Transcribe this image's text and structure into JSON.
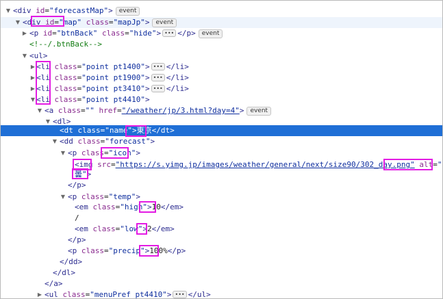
{
  "lines": [
    {
      "open": "<",
      "tag": "div",
      "a1n": "id",
      "a1v": "\"forecastMap\"",
      "close": ">",
      "badge": "event"
    },
    {
      "open": "<",
      "tag": "div",
      "a1n": "id",
      "a1v": "\"map\"",
      "a2n": "class",
      "a2v": "\"mapJp\"",
      "close": ">",
      "badge": "event"
    },
    {
      "open": "<",
      "tag": "p",
      "a1n": "id",
      "a1v": "\"btnBack\"",
      "a2n": "class",
      "a2v": "\"hide\"",
      "mid": ">",
      "dots": "•••",
      "end": "</p>",
      "badge": "event"
    },
    {
      "comment": "<!--/.btnBack-->"
    },
    {
      "open": "<",
      "tag": "ul",
      "close": ">"
    },
    {
      "open": "<",
      "tag": "li",
      "a1n": "class",
      "a1v": "\"point pt1400\"",
      "mid": ">",
      "dots": "•••",
      "end": "</li>"
    },
    {
      "open": "<",
      "tag": "li",
      "a1n": "class",
      "a1v": "\"point pt1900\"",
      "mid": ">",
      "dots": "•••",
      "end": "</li>"
    },
    {
      "open": "<",
      "tag": "li",
      "a1n": "class",
      "a1v": "\"point pt3410\"",
      "mid": ">",
      "dots": "•••",
      "end": "</li>"
    },
    {
      "open": "<",
      "tag": "li",
      "a1n": "class",
      "a1v": "\"point pt4410\"",
      "close": ">"
    },
    {
      "open": "<",
      "tag": "a",
      "a1n": "class",
      "a1v": "\"\"",
      "a2n": "href",
      "a2v": "\"/weather/jp/3.html?day=4\"",
      "close": ">",
      "badge": "event"
    },
    {
      "open": "<",
      "tag": "dl",
      "close": ">"
    },
    {
      "open": "<",
      "tag": "dt",
      "a1n": "class",
      "a1v": "\"name\"",
      "mid": ">",
      "text": "東京",
      "end": "</dt>"
    },
    {
      "open": "<",
      "tag": "dd",
      "a1n": "class",
      "a1v": "\"forecast\"",
      "close": ">"
    },
    {
      "open": "<",
      "tag": "p",
      "a1n": "class",
      "a1v": "\"icon\"",
      "close": ">"
    },
    {
      "open": "<",
      "tag": "img",
      "a1n": "src",
      "a1v": "\"https://s.yimg.jp/images/weather/general/next/size90/302_day.png\"",
      "a2n": "alt",
      "a2v": "\"雨時々"
    },
    {
      "text": "曇",
      "a2v": "\"",
      "close": ">"
    },
    {
      "end": "</p>"
    },
    {
      "open": "<",
      "tag": "p",
      "a1n": "class",
      "a1v": "\"temp\"",
      "close": ">"
    },
    {
      "open": "<",
      "tag": "em",
      "a1n": "class",
      "a1v": "\"high\"",
      "mid": ">",
      "text": "10",
      "end": "</em>"
    },
    {
      "text": "/"
    },
    {
      "open": "<",
      "tag": "em",
      "a1n": "class",
      "a1v": "\"low\"",
      "mid": ">",
      "text": "2",
      "end": "</em>"
    },
    {
      "end": "</p>"
    },
    {
      "open": "<",
      "tag": "p",
      "a1n": "class",
      "a1v": "\"precip\"",
      "mid": ">",
      "text": "100%",
      "end": "</p>"
    },
    {
      "end": "</dd>"
    },
    {
      "end": "</dl>"
    },
    {
      "end": "</a>"
    },
    {
      "open": "<",
      "tag": "ul",
      "a1n": "class",
      "a1v": "\"menuPref pt4410\"",
      "mid": ">",
      "dots": "•••",
      "end": "</ul>"
    }
  ],
  "colors": {
    "selection": "#1f6fd6",
    "highlight_box": "#e31be3"
  }
}
